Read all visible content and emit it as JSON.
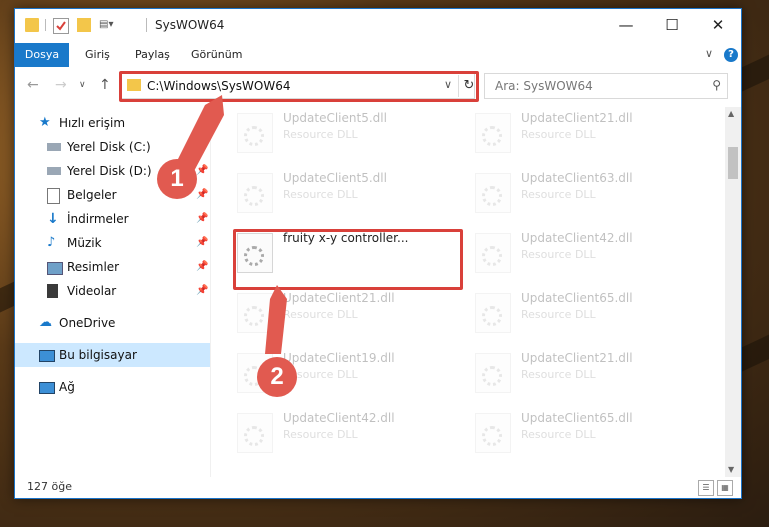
{
  "window": {
    "title": "SysWOW64"
  },
  "ribbon": {
    "tabs": [
      "Dosya",
      "Giriş",
      "Paylaş",
      "Görünüm"
    ],
    "help": "?"
  },
  "nav": {
    "address": "C:\\Windows\\SysWOW64",
    "search_placeholder": "Ara: SysWOW64"
  },
  "sidebar": {
    "items": [
      {
        "label": "Hızlı erişim",
        "icon": "star-icon",
        "pinned": false
      },
      {
        "label": "Yerel Disk (C:)",
        "icon": "drive-icon",
        "pinned": true
      },
      {
        "label": "Yerel Disk (D:)",
        "icon": "drive-icon",
        "pinned": true
      },
      {
        "label": "Belgeler",
        "icon": "document-icon",
        "pinned": true
      },
      {
        "label": "İndirmeler",
        "icon": "download-icon",
        "pinned": true
      },
      {
        "label": "Müzik",
        "icon": "music-icon",
        "pinned": true
      },
      {
        "label": "Resimler",
        "icon": "pictures-icon",
        "pinned": true
      },
      {
        "label": "Videolar",
        "icon": "video-icon",
        "pinned": true
      },
      {
        "label": "OneDrive",
        "icon": "cloud-icon",
        "pinned": false
      },
      {
        "label": "Bu bilgisayar",
        "icon": "computer-icon",
        "pinned": false
      },
      {
        "label": "Ağ",
        "icon": "network-icon",
        "pinned": false
      }
    ]
  },
  "files": {
    "left": [
      {
        "name": "UpdateClient5.dll",
        "type": "Resource DLL"
      },
      {
        "name": "UpdateClient5.dll",
        "type": "Resource DLL"
      },
      {
        "name": "fruity x-y controller...",
        "type": ""
      },
      {
        "name": "UpdateClient21.dll",
        "type": "Resource DLL"
      },
      {
        "name": "UpdateClient19.dll",
        "type": "Resource DLL"
      },
      {
        "name": "UpdateClient42.dll",
        "type": "Resource DLL"
      }
    ],
    "right": [
      {
        "name": "UpdateClient21.dll",
        "type": "Resource DLL"
      },
      {
        "name": "UpdateClient63.dll",
        "type": "Resource DLL"
      },
      {
        "name": "UpdateClient42.dll",
        "type": "Resource DLL"
      },
      {
        "name": "UpdateClient65.dll",
        "type": "Resource DLL"
      },
      {
        "name": "UpdateClient21.dll",
        "type": "Resource DLL"
      },
      {
        "name": "UpdateClient65.dll",
        "type": "Resource DLL"
      }
    ]
  },
  "status": {
    "count": "127 öğe"
  },
  "annotations": {
    "step1": "1",
    "step2": "2",
    "color": "#e15a50"
  }
}
